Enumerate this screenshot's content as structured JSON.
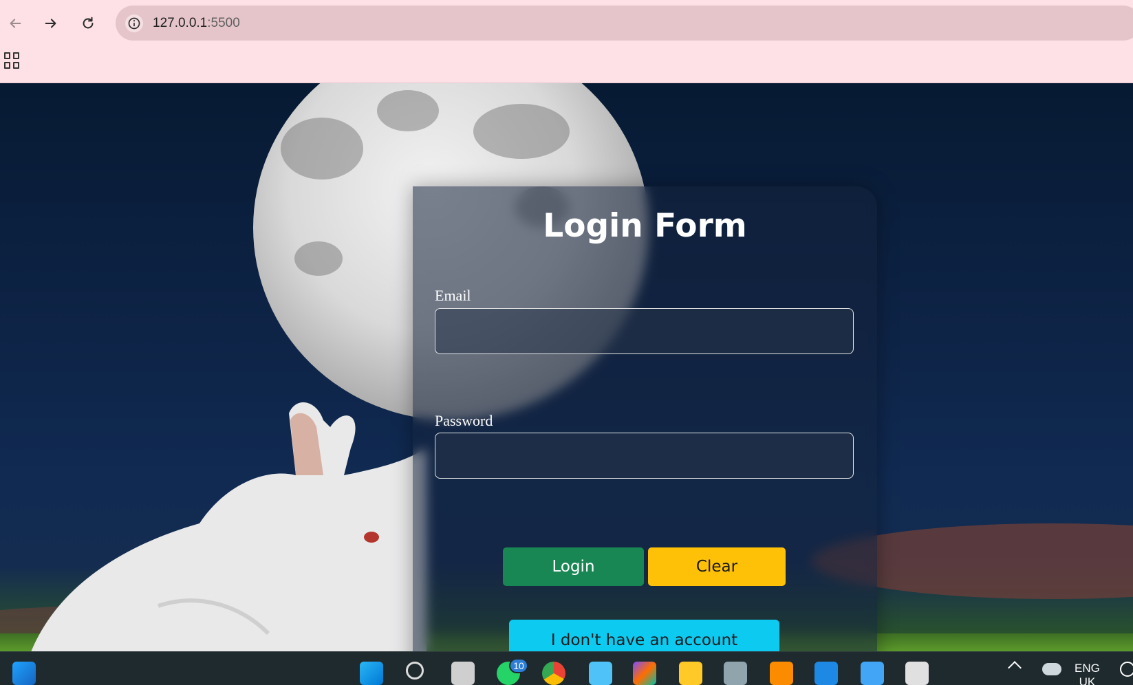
{
  "browser": {
    "url_host": "127.0.0.1",
    "url_port": ":5500",
    "icons": [
      "back-icon",
      "forward-icon",
      "reload-icon",
      "site-info-icon",
      "apps-icon"
    ]
  },
  "form": {
    "title": "Login Form",
    "email_label": "Email",
    "email_value": "",
    "password_label": "Password",
    "password_value": "",
    "login_button": "Login",
    "clear_button": "Clear",
    "account_button": "I don't have an account"
  },
  "colors": {
    "login": "#198754",
    "clear": "#ffc107",
    "account": "#0dcaf0"
  },
  "taskbar": {
    "whatsapp_badge": "10",
    "language_line1": "ENG",
    "language_line2": "UK",
    "apps": [
      "widgets-icon",
      "windows-start-icon",
      "search-icon",
      "task-view-icon",
      "whatsapp-icon",
      "chrome-icon",
      "notepad-icon",
      "copilot-icon",
      "file-explorer-icon",
      "virtualbox-icon",
      "xampp-icon",
      "vscode-icon",
      "photos-icon",
      "snipping-tool-icon"
    ]
  }
}
